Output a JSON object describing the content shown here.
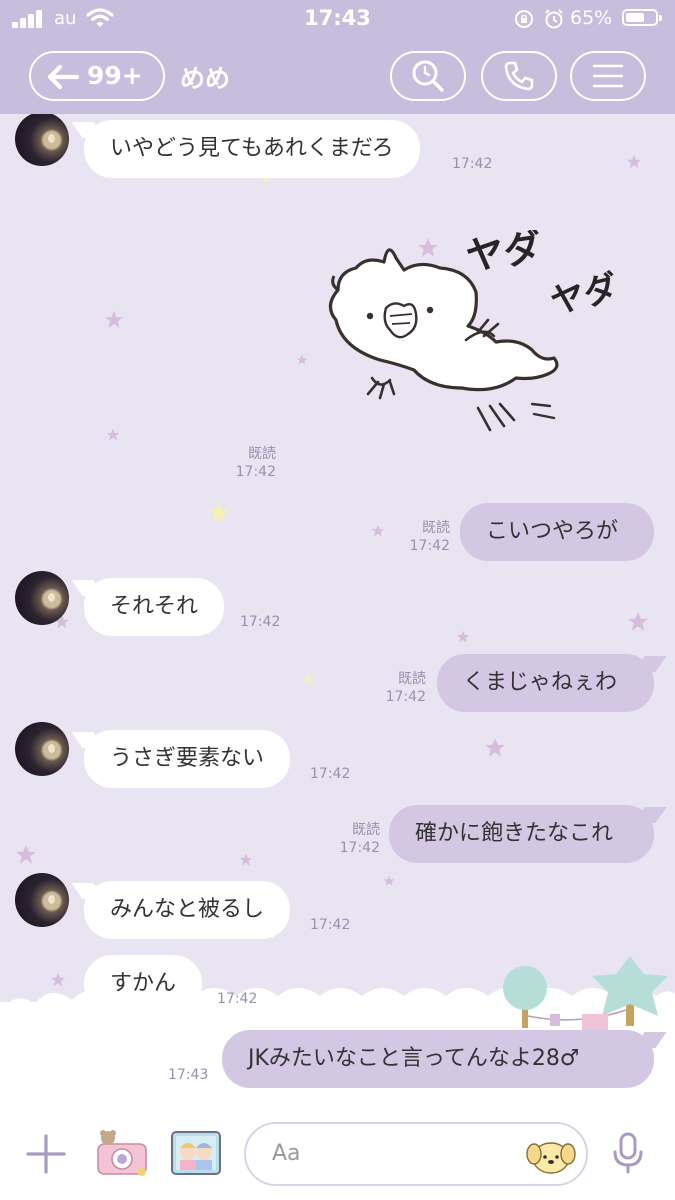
{
  "status_bar": {
    "carrier": "au",
    "time": "17:43",
    "battery_percent": "65%",
    "battery_level": 0.65,
    "icons": [
      "signal-icon",
      "wifi-icon",
      "orientation-lock-icon",
      "alarm-icon",
      "battery-icon"
    ]
  },
  "header": {
    "back_count": "99+",
    "chat_name": "めめ",
    "buttons": [
      "search-icon",
      "phone-icon",
      "menu-icon"
    ]
  },
  "messages": [
    {
      "direction": "in",
      "text": "いやどう見てもあれくまだろ",
      "time": "17:42",
      "avatar": true
    },
    {
      "direction": "out",
      "type": "sticker",
      "sticker": "white-creature-sticker",
      "sticker_text": [
        "ヤダ",
        "ヤダ"
      ],
      "read": "既読",
      "time": "17:42"
    },
    {
      "direction": "out",
      "text": "こいつやろが",
      "read": "既読",
      "time": "17:42"
    },
    {
      "direction": "in",
      "text": "それそれ",
      "time": "17:42",
      "avatar": true
    },
    {
      "direction": "out",
      "text": "くまじゃねぇわ",
      "read": "既読",
      "time": "17:42"
    },
    {
      "direction": "in",
      "text": "うさぎ要素ない",
      "time": "17:42",
      "avatar": true
    },
    {
      "direction": "out",
      "text": "確かに飽きたなこれ",
      "read": "既読",
      "time": "17:42"
    },
    {
      "direction": "in",
      "text": "みんなと被るし",
      "time": "17:42",
      "avatar": true
    },
    {
      "direction": "in",
      "text": "すかん",
      "time": "17:42",
      "avatar": false
    },
    {
      "direction": "out",
      "text": "JKみたいなこと言ってんなよ28♂",
      "read": "",
      "time": "17:43"
    }
  ],
  "input_bar": {
    "placeholder": "Aa",
    "icons": [
      "plus-icon",
      "camera-icon",
      "photo-icon",
      "emoji-icon",
      "microphone-icon"
    ]
  },
  "colors": {
    "header": "#c7bedd",
    "chat_background": "#e9e4f1",
    "outgoing_bubble": "#d3c7e3",
    "incoming_bubble": "#ffffff",
    "timestamp": "#9a8fb0"
  }
}
